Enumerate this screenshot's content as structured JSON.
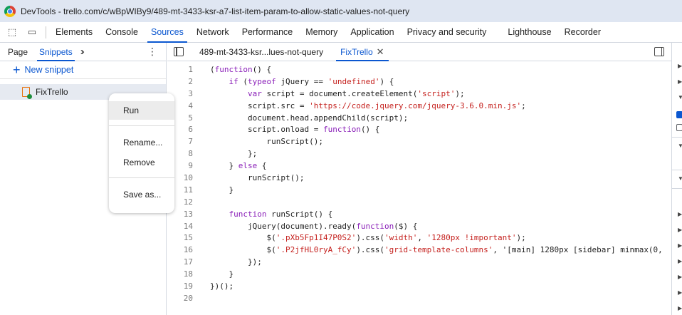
{
  "window": {
    "title": "DevTools - trello.com/c/wBpWIBy9/489-mt-3433-ksr-a7-list-item-param-to-allow-static-values-not-query"
  },
  "main_tabs": [
    {
      "label": "Elements"
    },
    {
      "label": "Console"
    },
    {
      "label": "Sources"
    },
    {
      "label": "Network"
    },
    {
      "label": "Performance"
    },
    {
      "label": "Memory"
    },
    {
      "label": "Application"
    },
    {
      "label": "Privacy and security"
    },
    {
      "label": "Lighthouse"
    },
    {
      "label": "Recorder"
    }
  ],
  "active_main_tab": "Sources",
  "navigator": {
    "tabs": [
      {
        "label": "Page"
      },
      {
        "label": "Snippets"
      }
    ],
    "active_tab": "Snippets",
    "new_snippet_label": "New snippet",
    "snippet_item": "FixTrello"
  },
  "context_menu": {
    "items": [
      "Run",
      "Rename...",
      "Remove",
      "Save as..."
    ]
  },
  "editor": {
    "tabs": [
      {
        "label": "489-mt-3433-ksr...lues-not-query"
      },
      {
        "label": "FixTrello"
      }
    ],
    "active_tab": "FixTrello",
    "lines": [
      "(function() {",
      "    if (typeof jQuery == 'undefined') {",
      "        var script = document.createElement('script');",
      "        script.src = 'https://code.jquery.com/jquery-3.6.0.min.js';",
      "        document.head.appendChild(script);",
      "        script.onload = function() {",
      "            runScript();",
      "        };",
      "    } else {",
      "        runScript();",
      "    }",
      "",
      "    function runScript() {",
      "        jQuery(document).ready(function($) {",
      "            $('.pXb5Fp1I47P0S2').css('width', '1280px !important');",
      "            $('.P2jfHL0ryA_fCy').css('grid-template-columns', '[main] 1280px [sidebar] minmax(0,",
      "        });",
      "    }",
      "})();",
      ""
    ]
  },
  "colors": {
    "accent": "#0b57d0",
    "keyword": "#8b21b9",
    "string": "#c5221f"
  }
}
